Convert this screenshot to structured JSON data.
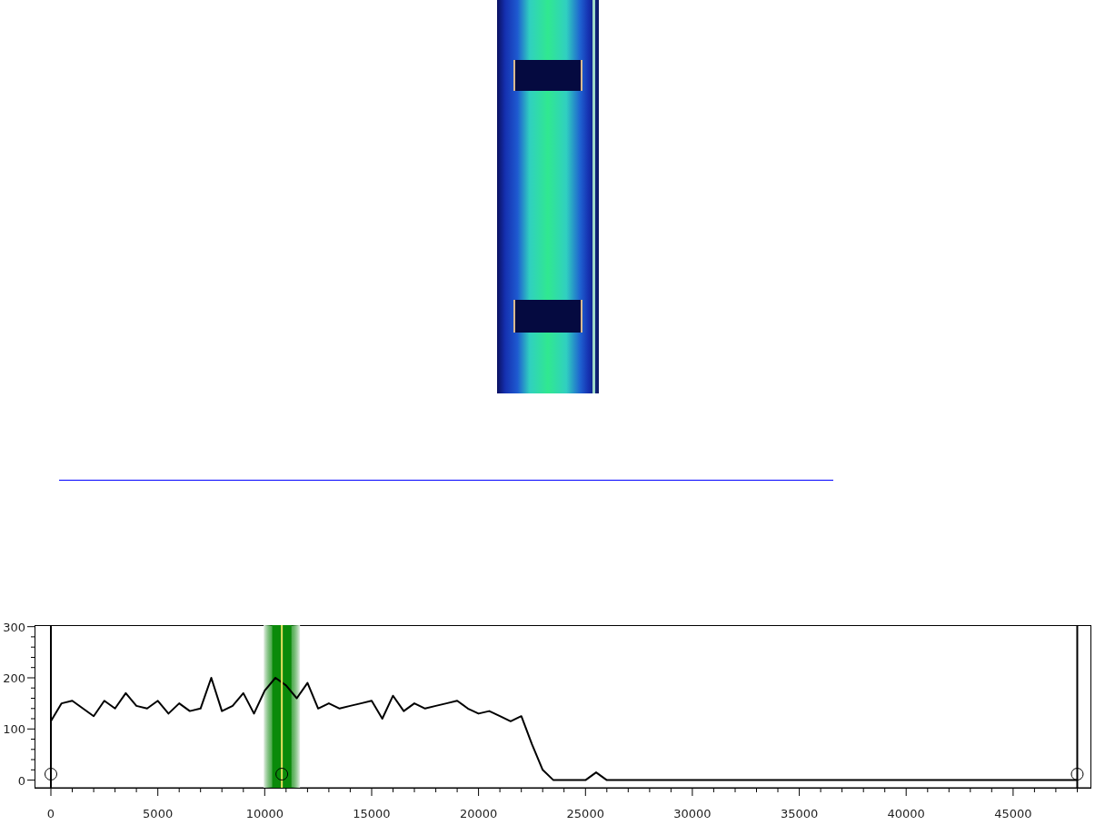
{
  "spectrum": {
    "chart_data": {
      "type": "line",
      "x": [
        0,
        500,
        1000,
        1500,
        2000,
        2500,
        3000,
        3500,
        4000,
        4500,
        5000,
        5500,
        6000,
        6500,
        7000,
        7500,
        8000,
        8500,
        9000,
        9500,
        10000,
        10500,
        11000,
        11500,
        12000,
        12500,
        13000,
        13500,
        14000,
        14500,
        15000,
        15500,
        16000,
        16500,
        17000,
        17500,
        18000,
        18500,
        19000,
        19500,
        20000,
        20500,
        21000,
        21500,
        22000,
        22500,
        23000,
        23500,
        24000,
        24500,
        25000,
        25500,
        26000,
        26500,
        27000,
        27500,
        28000,
        28500,
        29000,
        29500,
        30000,
        30500,
        31000,
        31500,
        32000,
        32500,
        33000,
        33500,
        34000,
        34500,
        35000,
        35500,
        36000,
        36500,
        37000,
        37500,
        38000,
        38500,
        39000,
        39500,
        40000,
        40500,
        41000,
        41500,
        42000,
        42500,
        43000,
        43500,
        44000,
        44500,
        45000,
        45500,
        46000,
        46500,
        47000,
        47500,
        48000
      ],
      "series": [
        {
          "color": "#000000",
          "values": [
            115,
            150,
            155,
            140,
            125,
            155,
            140,
            170,
            145,
            140,
            155,
            130,
            150,
            135,
            140,
            200,
            135,
            145,
            170,
            130,
            175,
            200,
            185,
            160,
            190,
            140,
            150,
            140,
            145,
            150,
            155,
            120,
            165,
            135,
            150,
            140,
            145,
            150,
            155,
            140,
            130,
            135,
            125,
            115,
            125,
            70,
            20,
            0,
            0,
            0,
            0,
            15,
            0,
            0,
            0,
            0,
            0,
            0,
            0,
            0,
            0,
            0,
            0,
            0,
            0,
            0,
            0,
            0,
            0,
            0,
            0,
            0,
            0,
            0,
            0,
            0,
            0,
            0,
            0,
            0,
            0,
            0,
            0,
            0,
            0,
            0,
            0,
            0,
            0,
            0,
            0,
            0,
            0,
            0,
            0,
            0,
            0
          ]
        }
      ],
      "xlim": [
        -765,
        48660
      ],
      "ylim": [
        -15,
        303
      ],
      "xticks": [
        0,
        5000,
        10000,
        15000,
        20000,
        25000,
        30000,
        35000,
        40000,
        45000
      ],
      "yticks": [
        0,
        100,
        200,
        300
      ],
      "ref_lines": [
        {
          "axis": "x",
          "value": 0,
          "color": "#000000"
        },
        {
          "axis": "x",
          "value": 10800,
          "color": "#e8e060"
        },
        {
          "axis": "x",
          "value": 48000,
          "color": "#000000"
        }
      ],
      "bands": [
        {
          "axis": "x",
          "from": 9950,
          "to": 11650,
          "color": "#0a8a0a"
        }
      ]
    }
  }
}
